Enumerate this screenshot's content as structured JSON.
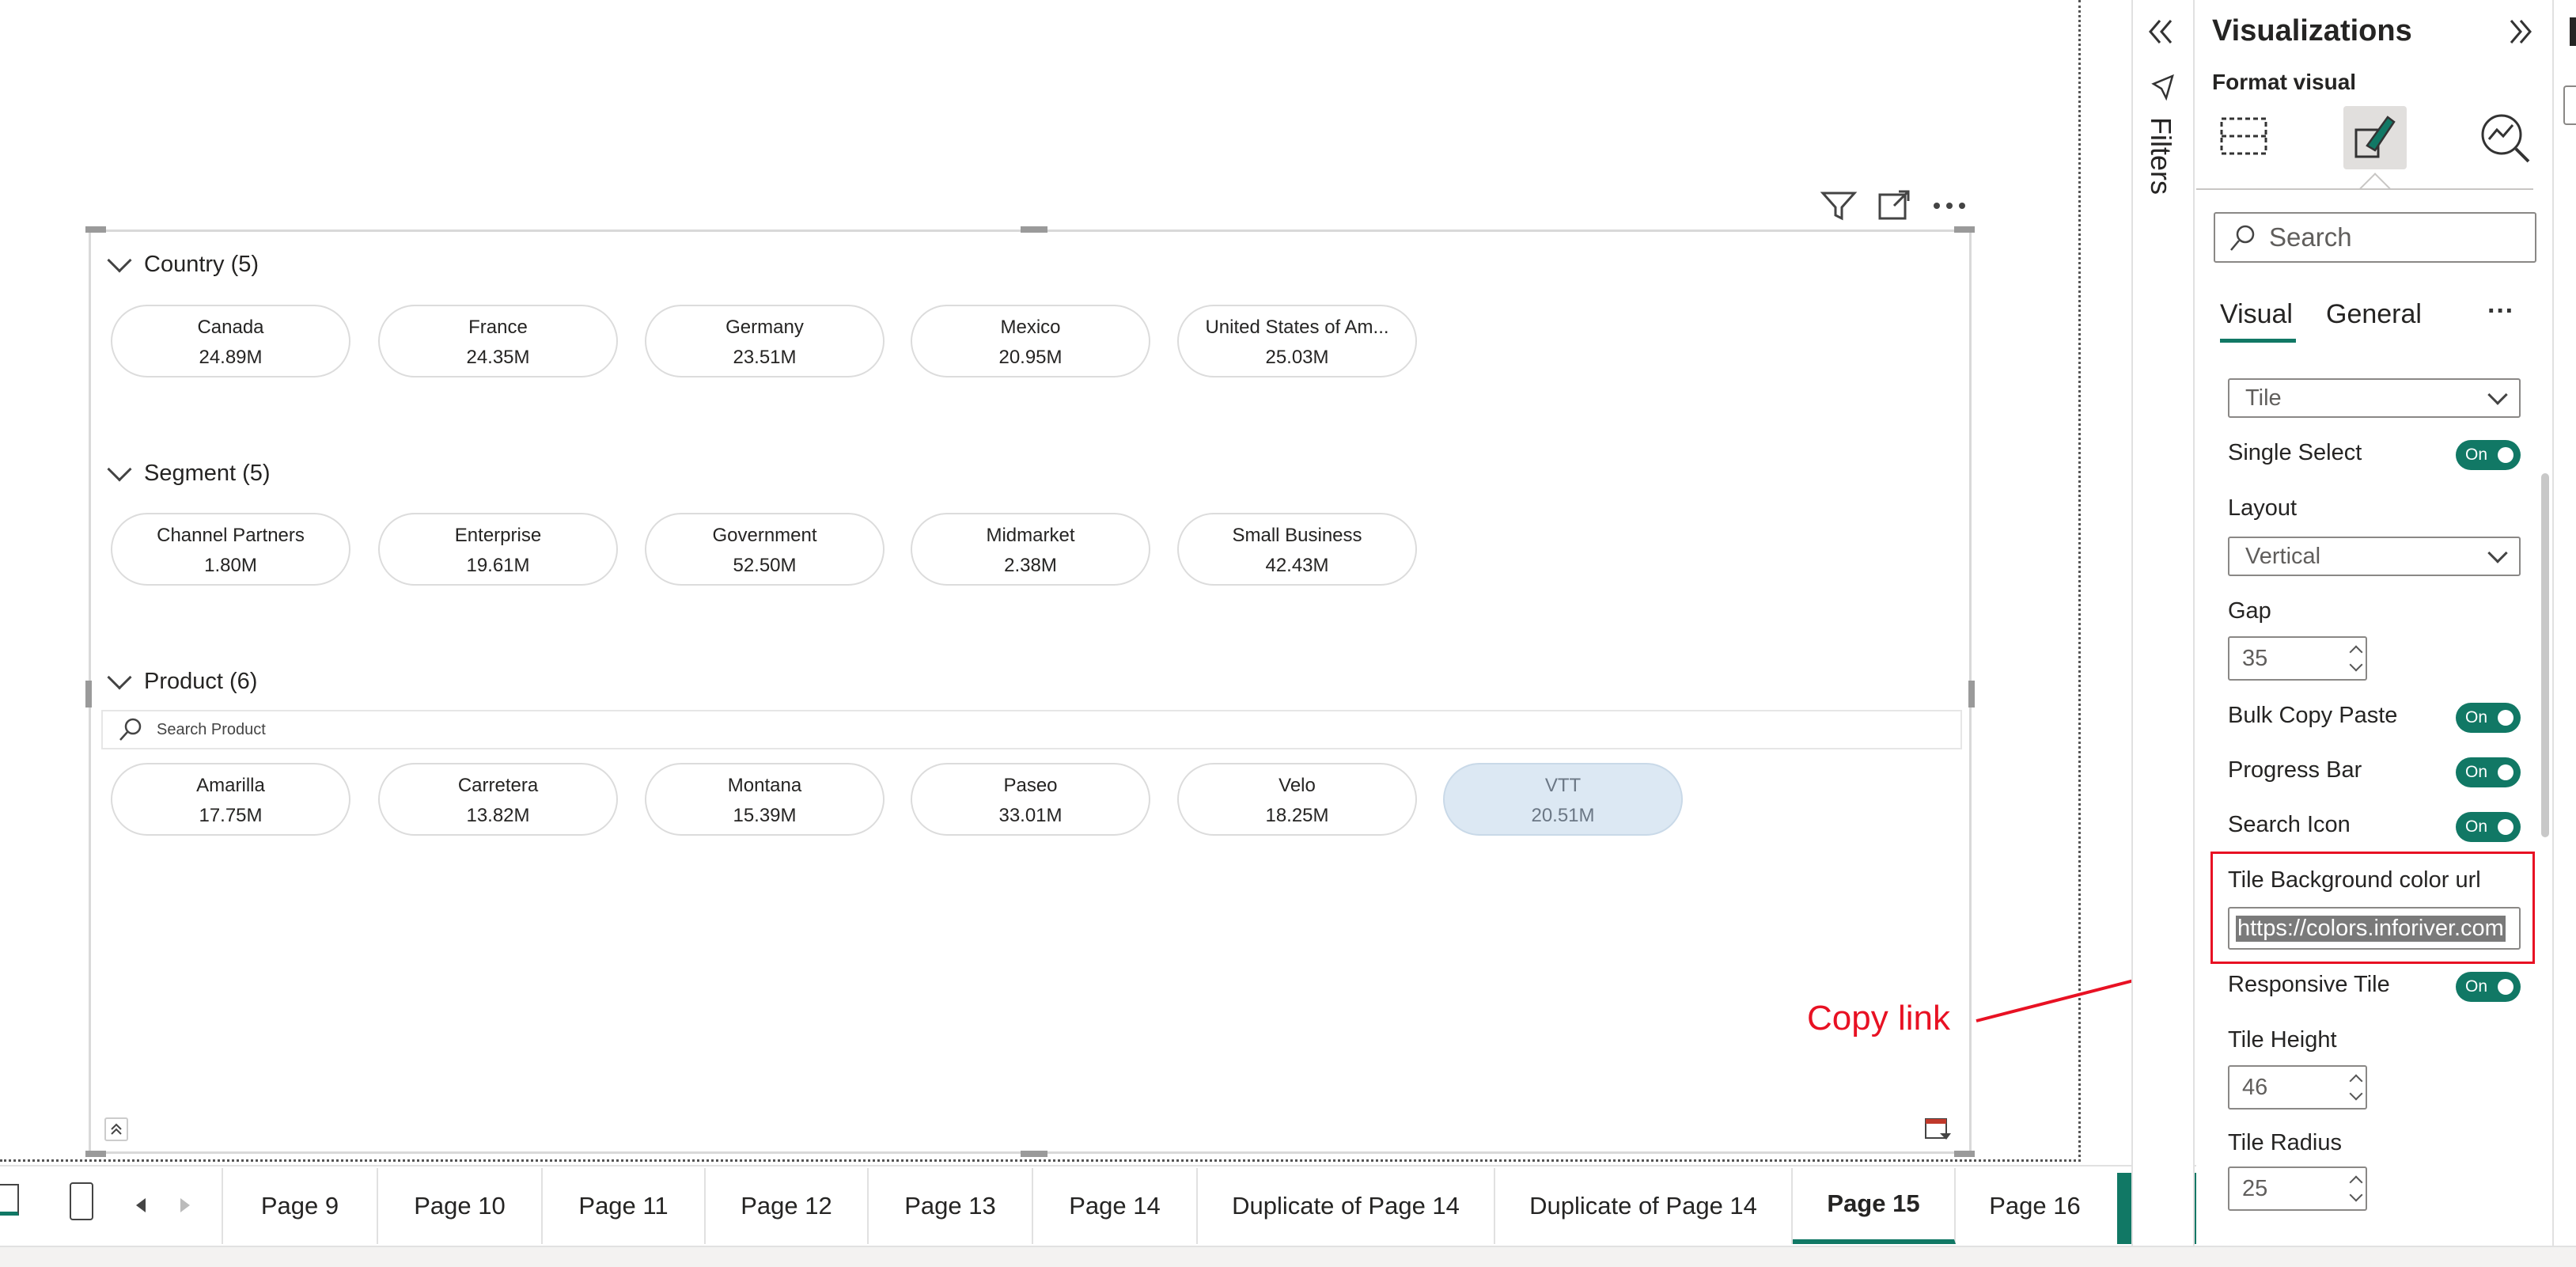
{
  "report": {
    "sections": [
      {
        "title": "Country (5)",
        "tiles": [
          {
            "name": "Canada",
            "value": "24.89M"
          },
          {
            "name": "France",
            "value": "24.35M"
          },
          {
            "name": "Germany",
            "value": "23.51M"
          },
          {
            "name": "Mexico",
            "value": "20.95M"
          },
          {
            "name": "United States of Am...",
            "value": "25.03M"
          }
        ]
      },
      {
        "title": "Segment (5)",
        "tiles": [
          {
            "name": "Channel Partners",
            "value": "1.80M"
          },
          {
            "name": "Enterprise",
            "value": "19.61M"
          },
          {
            "name": "Government",
            "value": "52.50M"
          },
          {
            "name": "Midmarket",
            "value": "2.38M"
          },
          {
            "name": "Small Business",
            "value": "42.43M"
          }
        ]
      },
      {
        "title": "Product (6)",
        "search_placeholder": "Search Product",
        "tiles": [
          {
            "name": "Amarilla",
            "value": "17.75M"
          },
          {
            "name": "Carretera",
            "value": "13.82M"
          },
          {
            "name": "Montana",
            "value": "15.39M"
          },
          {
            "name": "Paseo",
            "value": "33.01M"
          },
          {
            "name": "Velo",
            "value": "18.25M"
          },
          {
            "name": "VTT",
            "value": "20.51M",
            "selected": true
          }
        ]
      }
    ],
    "annotation": {
      "text": "Copy link",
      "color": "#e81123"
    }
  },
  "pages": {
    "tabs": [
      "Page 9",
      "Page 10",
      "Page 11",
      "Page 12",
      "Page 13",
      "Page 14",
      "Duplicate of Page 14",
      "Duplicate of Page 14",
      "Page 15",
      "Page 16"
    ],
    "active": "Page 15",
    "add_label": "+"
  },
  "filters": {
    "label": "Filters"
  },
  "viz": {
    "title": "Visualizations",
    "subtitle": "Format visual",
    "search_placeholder": "Search",
    "tabs": [
      "Visual",
      "General"
    ],
    "more": "···",
    "settings": {
      "style_value": "Tile",
      "single_select": {
        "label": "Single Select",
        "state": "On"
      },
      "layout": {
        "label": "Layout",
        "value": "Vertical"
      },
      "gap": {
        "label": "Gap",
        "value": "35"
      },
      "bulk_copy": {
        "label": "Bulk Copy Paste",
        "state": "On"
      },
      "progress_bar": {
        "label": "Progress Bar",
        "state": "On"
      },
      "search_icon": {
        "label": "Search Icon",
        "state": "On"
      },
      "tile_bg": {
        "label": "Tile Background color url",
        "value": "https://colors.inforiver.com"
      },
      "responsive": {
        "label": "Responsive Tile",
        "state": "On"
      },
      "tile_height": {
        "label": "Tile Height",
        "value": "46"
      },
      "tile_radius": {
        "label": "Tile Radius",
        "value": "25"
      }
    }
  },
  "colors": {
    "accent": "#117865",
    "annotation": "#e81123",
    "selected_tile": "#dce8f3"
  }
}
